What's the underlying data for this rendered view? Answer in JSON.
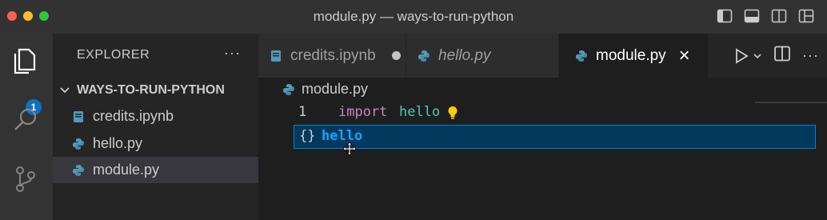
{
  "window": {
    "title": "module.py — ways-to-run-python",
    "traffic_lights": [
      "#ff5f57",
      "#febc2e",
      "#28c840"
    ]
  },
  "activity_bar": {
    "explorer_badge": "1"
  },
  "sidebar": {
    "title": "EXPLORER",
    "more": "···",
    "folder": "WAYS-TO-RUN-PYTHON",
    "files": [
      {
        "name": "credits.ipynb",
        "icon": "notebook-icon"
      },
      {
        "name": "hello.py",
        "icon": "python-icon"
      },
      {
        "name": "module.py",
        "icon": "python-icon",
        "selected": true
      }
    ]
  },
  "tabs": [
    {
      "label": "credits.ipynb",
      "icon": "notebook-icon",
      "state": "modified-dot"
    },
    {
      "label": "hello.py",
      "icon": "python-icon",
      "italic": true
    },
    {
      "label": "module.py",
      "icon": "python-icon",
      "active": true,
      "close": "×"
    }
  ],
  "tab_actions": {
    "more": "···"
  },
  "editor": {
    "breadcrumb": "module.py",
    "line_number": "1",
    "keyword": "import",
    "module": "hello",
    "suggestion": {
      "icon": "{}",
      "label": "hello"
    }
  },
  "colors": {
    "accent": "#0e70c0",
    "keyword": "#c586c0",
    "type": "#4ec9b0",
    "suggest_bg": "#04395e",
    "suggest_text": "#18a3ff",
    "python_blue": "#519aba",
    "notebook_blue": "#519aba",
    "lightbulb": "#ffcc00"
  }
}
